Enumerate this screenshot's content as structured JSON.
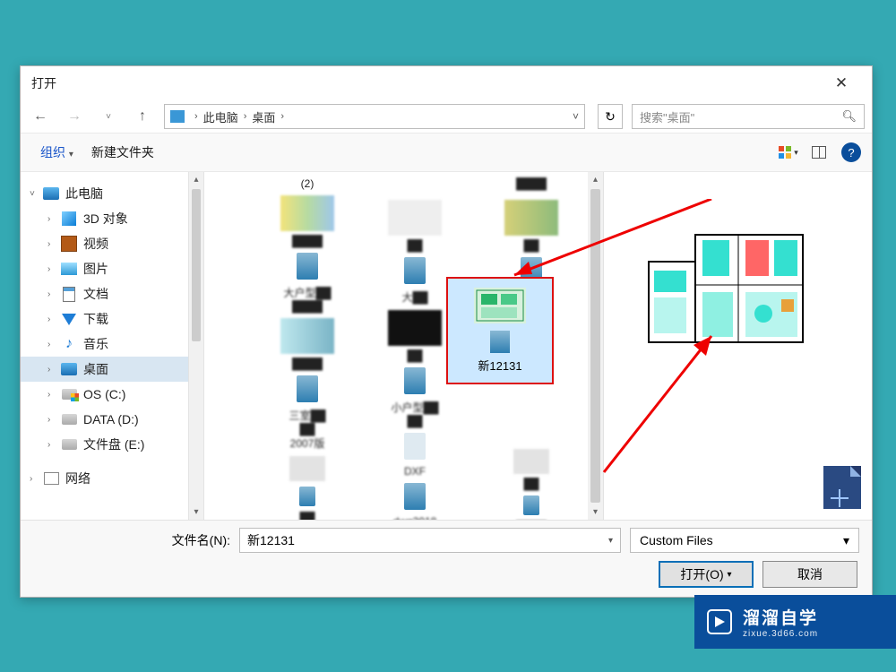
{
  "title": "打开",
  "nav": {
    "breadcrumb": [
      "此电脑",
      "桌面"
    ]
  },
  "search": {
    "placeholder": "搜索\"桌面\""
  },
  "toolbar": {
    "organize": "组织",
    "newfolder": "新建文件夹"
  },
  "sidebar": {
    "root": "此电脑",
    "items": [
      "3D 对象",
      "视频",
      "图片",
      "文档",
      "下载",
      "音乐",
      "桌面",
      "OS (C:)",
      "DATA (D:)",
      "文件盘 (E:)"
    ],
    "network": "网络"
  },
  "filelist": {
    "header0": "(2)",
    "selected_label": "新12131"
  },
  "bottom": {
    "filename_label": "文件名(N):",
    "filename_value": "新12131",
    "filter": "Custom Files",
    "open": "打开(O)",
    "cancel": "取消"
  },
  "watermark": {
    "cn": "溜溜自学",
    "en": "zixue.3d66.com"
  }
}
